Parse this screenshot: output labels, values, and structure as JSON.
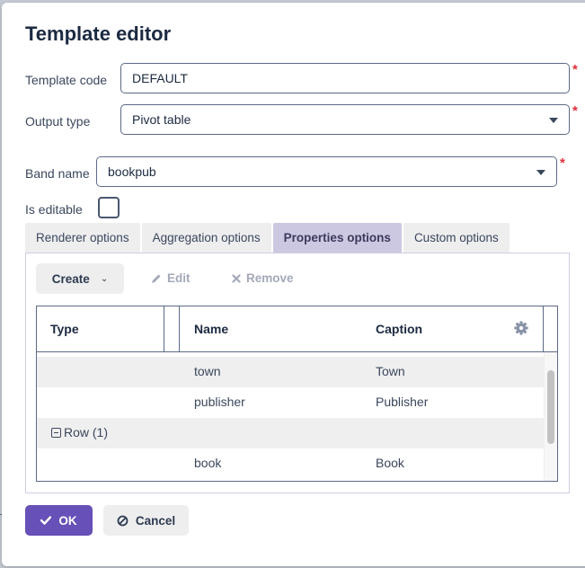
{
  "dialog": {
    "title": "Template editor"
  },
  "form": {
    "template_code": {
      "label": "Template code",
      "value": "DEFAULT",
      "required": true
    },
    "output_type": {
      "label": "Output type",
      "value": "Pivot table",
      "required": true
    },
    "band_name": {
      "label": "Band name",
      "value": "bookpub",
      "required": true
    },
    "is_editable": {
      "label": "Is editable",
      "checked": false
    }
  },
  "tabs": [
    {
      "label": "Renderer options",
      "active": false
    },
    {
      "label": "Aggregation options",
      "active": false
    },
    {
      "label": "Properties options",
      "active": true
    },
    {
      "label": "Custom options",
      "active": false
    }
  ],
  "toolbar": {
    "create_label": "Create",
    "edit_label": "Edit",
    "remove_label": "Remove"
  },
  "grid": {
    "columns": [
      "Type",
      "Name",
      "Caption"
    ],
    "rows": [
      {
        "type": "",
        "name": "town",
        "caption": "Town"
      },
      {
        "type": "",
        "name": "publisher",
        "caption": "Publisher"
      },
      {
        "type": "Row (1)",
        "name": "",
        "caption": "",
        "group": true
      },
      {
        "type": "",
        "name": "book",
        "caption": "Book"
      }
    ]
  },
  "buttons": {
    "ok_label": "OK",
    "cancel_label": "Cancel"
  },
  "colors": {
    "primary": "#6750b7",
    "required": "#e0303c",
    "active_tab": "#cdc8e2"
  }
}
